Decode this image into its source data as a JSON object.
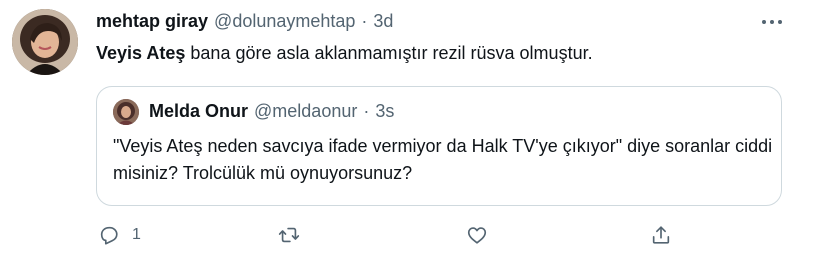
{
  "tweet": {
    "author": {
      "display_name": "mehtap giray",
      "handle": "@dolunaymehtap",
      "separator": "·",
      "time": "3d"
    },
    "text": {
      "bold": "Veyis Ateş",
      "rest": " bana göre asla aklanmamıştır rezil rüsva olmuştur."
    },
    "more_icon": "more-horizontal-icon",
    "quote": {
      "display_name": "Melda Onur",
      "handle": "@meldaonur",
      "separator": "·",
      "time": "3s",
      "text": "\"Veyis Ateş neden savcıya ifade vermiyor da Halk TV'ye çıkıyor\" diye soranlar ciddi misiniz? Trolcülük mü oynuyorsunuz?"
    },
    "actions": {
      "reply": {
        "icon": "reply-icon",
        "count": "1"
      },
      "retweet": {
        "icon": "retweet-icon"
      },
      "like": {
        "icon": "like-icon"
      },
      "share": {
        "icon": "share-icon"
      }
    },
    "colors": {
      "text": "#0f1419",
      "secondary": "#536471",
      "border": "#cfd9de"
    }
  }
}
